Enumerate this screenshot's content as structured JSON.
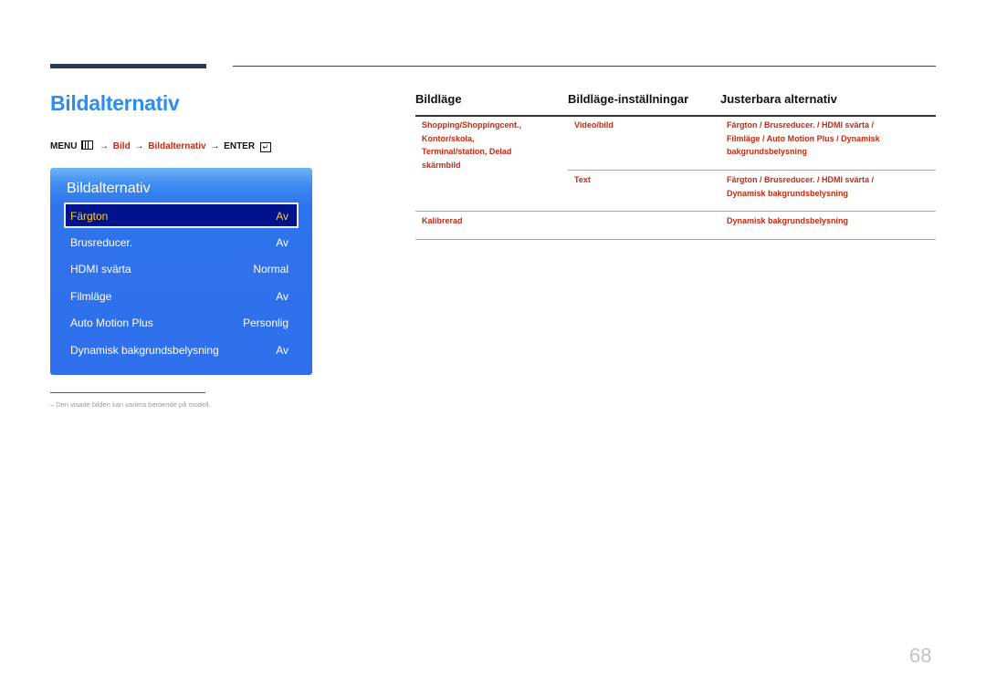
{
  "page": {
    "title": "Bildalternativ",
    "page_number": "68"
  },
  "nav_path": {
    "menu": "MENU",
    "arrow": "→",
    "step1": "Bild",
    "step2": "Bildalternativ",
    "enter": "ENTER",
    "menu_icon": "menu-grid-icon",
    "enter_icon": "enter-icon"
  },
  "osd": {
    "title": "Bildalternativ",
    "items": [
      {
        "label": "Färgton",
        "value": "Av",
        "selected": true
      },
      {
        "label": "Brusreducer.",
        "value": "Av"
      },
      {
        "label": "HDMI svärta",
        "value": "Normal"
      },
      {
        "label": "Filmläge",
        "value": "Av"
      },
      {
        "label": "Auto Motion Plus",
        "value": "Personlig"
      },
      {
        "label": "Dynamisk bakgrundsbelysning",
        "value": "Av"
      }
    ]
  },
  "footnote": {
    "dash": "–",
    "text": "Den visade bilden kan variera beroende på modell."
  },
  "table": {
    "headers": [
      "Bildläge",
      "Bildläge-inställningar",
      "Justerbara alternativ"
    ],
    "rows": [
      {
        "mode_lines": [
          "Shopping/Shoppingcent.,",
          "Kontor/skola,",
          "Terminal/station, Delad",
          "skärmbild"
        ],
        "settings": [
          {
            "name": "Video/bild",
            "options_lines": [
              "Färgton / Brusreducer. / HDMI svärta /",
              "Filmläge / Auto Motion Plus / Dynamisk",
              "bakgrundsbelysning"
            ]
          },
          {
            "name": "Text",
            "options_lines": [
              "Färgton / Brusreducer. / HDMI svärta /",
              "Dynamisk bakgrundsbelysning"
            ]
          }
        ]
      },
      {
        "mode_lines": [
          "Kalibrerad"
        ],
        "settings": [
          {
            "name": "",
            "options_lines": [
              "Dynamisk bakgrundsbelysning"
            ]
          }
        ]
      }
    ]
  }
}
